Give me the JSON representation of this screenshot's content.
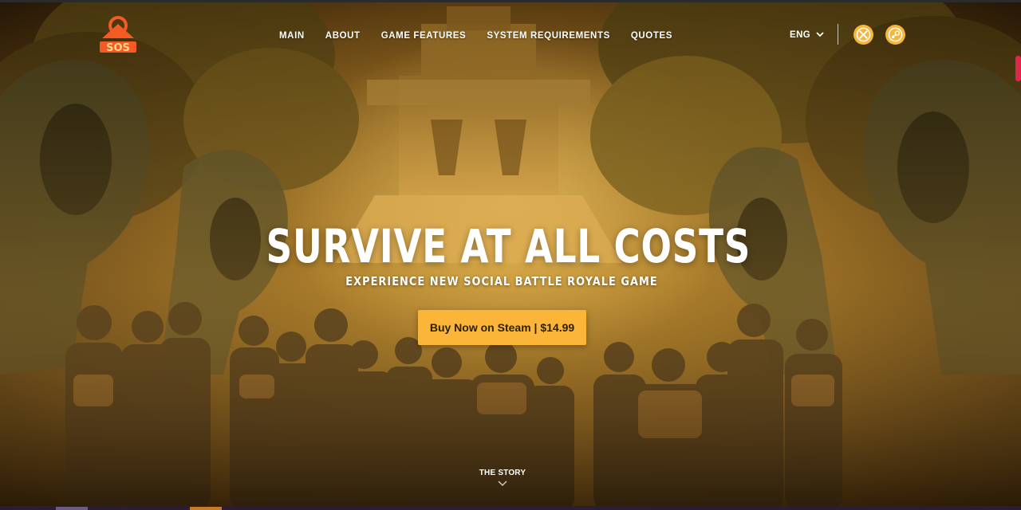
{
  "brand": {
    "logo_text": "SOS",
    "logo_color": "#f35a24",
    "accent": "#fbb63a"
  },
  "nav": {
    "items": [
      {
        "label": "MAIN"
      },
      {
        "label": "ABOUT"
      },
      {
        "label": "GAME FEATURES"
      },
      {
        "label": "SYSTEM REQUIREMENTS"
      },
      {
        "label": "QUOTES"
      }
    ]
  },
  "header": {
    "language": "ENG",
    "platforms": [
      {
        "icon": "xbox-icon"
      },
      {
        "icon": "steam-icon"
      }
    ]
  },
  "hero": {
    "title": "SURVIVE AT ALL COSTS",
    "subtitle": "EXPERIENCE NEW SOCIAL BATTLE ROYALE GAME",
    "cta_label": "Buy Now on Steam | $14.99"
  },
  "footer": {
    "story_label": "THE STORY"
  },
  "colors": {
    "cta_background": "#fbb63a",
    "text": "#ffffff",
    "scroll_indicator": "#e0244a"
  }
}
